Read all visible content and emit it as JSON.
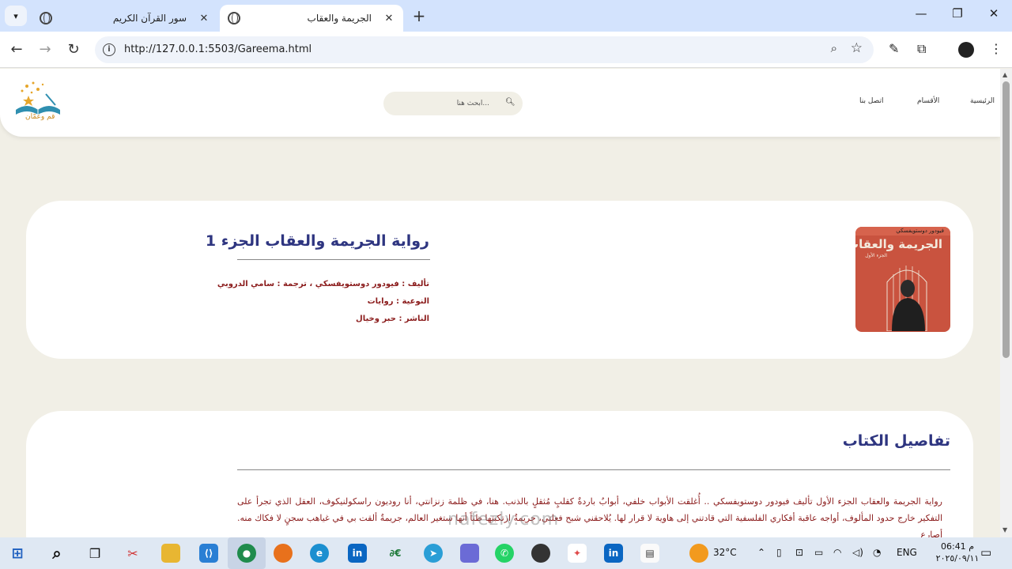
{
  "browser": {
    "tabs": [
      {
        "title": "سور القرآن الكريم",
        "active": false
      },
      {
        "title": "الجريمة والعقاب",
        "active": true
      }
    ],
    "url": "http://127.0.0.1:5503/Gareema.html"
  },
  "site": {
    "logo_text": "قم وعمّان",
    "search_placeholder": "...ابحث هنا",
    "nav": [
      "الرئيسية",
      "الأقسام",
      "اتصل بنا"
    ]
  },
  "book": {
    "cover": {
      "author": "فيودور دوستويفسكي",
      "title": "الجريمة والعقاب",
      "subtitle": "الجزء الأول"
    },
    "title": "رواية الجريمة والعقاب الجزء 1",
    "author_line": "تأليف : فيودور دوستويفسكي ، ترجمة : سامي الدروبي",
    "genre_line": "النوعية : روايات",
    "publisher_line": "الناشر : حبر وخيال"
  },
  "details": {
    "heading": "تفاصيل الكتاب",
    "paragraph": "رواية الجريمة والعقاب الجزء الأول تأليف فيودور دوستويفسكي .. أُغلقت الأبواب خلفي، أبوابٌ باردةٌ كقلبٍ مُثقلٍ بالذنب. هنا، في ظلمة زنزانتي، أنا روديون راسكولنيكوف، العقل الذي تجرأ على التفكير خارج حدود المألوف، أواجه عاقبة أفكاري الفلسفية التي قادتني إلى هاوية لا قرار لها. يُلاحقني شبح فعلتي، جريمةٌ ارتكبتها ظناً أنها ستغير العالم، جريمةٌ ألقت بي في غياهب سجنٍ لا فكاك منه. أصارع"
  },
  "taskbar": {
    "weather": "32°C",
    "lang": "ENG",
    "time": "06:41 م",
    "date": "٢٠٢٥/٠٩/١١"
  },
  "watermark": "nafezly.com"
}
